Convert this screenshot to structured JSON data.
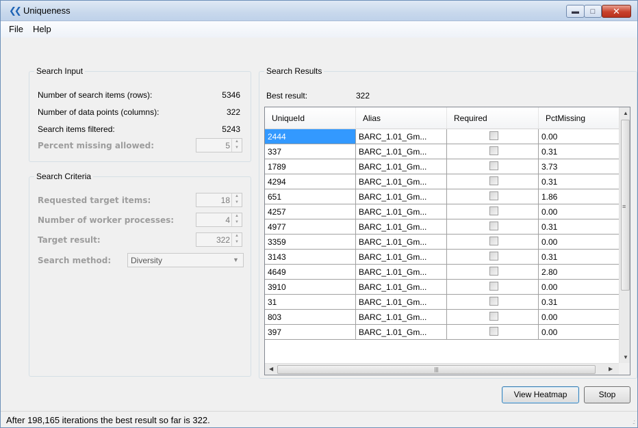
{
  "window": {
    "title": "Uniqueness",
    "app_icon": "app-logo-icon"
  },
  "menu": [
    "File",
    "Help"
  ],
  "search_input": {
    "title": "Search Input",
    "items_label": "Number of search items (rows):",
    "items_value": "5346",
    "points_label": "Number of data points (columns):",
    "points_value": "322",
    "filtered_label": "Search items filtered:",
    "filtered_value": "5243",
    "percent_label": "Percent missing allowed:",
    "percent_value": "5"
  },
  "search_criteria": {
    "title": "Search Criteria",
    "target_label": "Requested target items:",
    "target_value": "18",
    "workers_label": "Number of worker processes:",
    "workers_value": "4",
    "result_label": "Target result:",
    "result_value": "322",
    "method_label": "Search method:",
    "method_value": "Diversity"
  },
  "search_results": {
    "title": "Search Results",
    "best_label": "Best result:",
    "best_value": "322",
    "columns": [
      "UniqueId",
      "Alias",
      "Required",
      "PctMissing"
    ],
    "rows": [
      [
        "2444",
        "BARC_1.01_Gm...",
        "",
        "0.00"
      ],
      [
        "337",
        "BARC_1.01_Gm...",
        "",
        "0.31"
      ],
      [
        "1789",
        "BARC_1.01_Gm...",
        "",
        "3.73"
      ],
      [
        "4294",
        "BARC_1.01_Gm...",
        "",
        "0.31"
      ],
      [
        "651",
        "BARC_1.01_Gm...",
        "",
        "1.86"
      ],
      [
        "4257",
        "BARC_1.01_Gm...",
        "",
        "0.00"
      ],
      [
        "4977",
        "BARC_1.01_Gm...",
        "",
        "0.31"
      ],
      [
        "3359",
        "BARC_1.01_Gm...",
        "",
        "0.00"
      ],
      [
        "3143",
        "BARC_1.01_Gm...",
        "",
        "0.31"
      ],
      [
        "4649",
        "BARC_1.01_Gm...",
        "",
        "2.80"
      ],
      [
        "3910",
        "BARC_1.01_Gm...",
        "",
        "0.00"
      ],
      [
        "31",
        "BARC_1.01_Gm...",
        "",
        "0.31"
      ],
      [
        "803",
        "BARC_1.01_Gm...",
        "",
        "0.00"
      ],
      [
        "397",
        "BARC_1.01_Gm...",
        "",
        "0.00"
      ]
    ]
  },
  "buttons": {
    "heatmap": "View Heatmap",
    "stop": "Stop"
  },
  "status": "After 198,165 iterations the best result so far is 322."
}
